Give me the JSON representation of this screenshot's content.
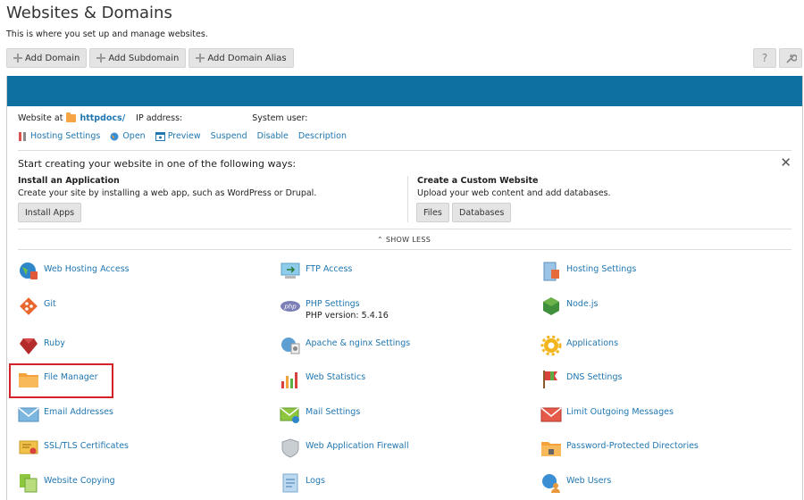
{
  "page": {
    "title": "Websites & Domains",
    "description": "This is where you set up and manage websites."
  },
  "toolbar": {
    "add_domain": "Add Domain",
    "add_subdomain": "Add Subdomain",
    "add_domain_alias": "Add Domain Alias",
    "help_glyph": "?",
    "tools_glyph": "🔧"
  },
  "site": {
    "website_at_label": "Website at",
    "docroot_link": "httpdocs/",
    "ip_label": "IP address:",
    "ip_value": "",
    "system_user_label": "System user:",
    "system_user_value": ""
  },
  "actions": {
    "hosting_settings": "Hosting Settings",
    "open": "Open",
    "preview": "Preview",
    "suspend": "Suspend",
    "disable": "Disable",
    "description": "Description"
  },
  "start": {
    "title": "Start creating your website in one of the following ways:",
    "close_glyph": "✕",
    "install_title": "Install an Application",
    "install_desc": "Create your site by installing a web app, such as WordPress or Drupal.",
    "install_button": "Install Apps",
    "custom_title": "Create a Custom Website",
    "custom_desc": "Upload your web content and add databases.",
    "files_button": "Files",
    "databases_button": "Databases",
    "show_less": "SHOW LESS",
    "chevron_glyph": "⌃"
  },
  "tools": [
    {
      "label": "Web Hosting Access",
      "icon": "web-hosting-access-icon"
    },
    {
      "label": "FTP Access",
      "icon": "ftp-access-icon"
    },
    {
      "label": "Hosting Settings",
      "icon": "hosting-settings-icon"
    },
    {
      "label": "Git",
      "icon": "git-icon"
    },
    {
      "label": "PHP Settings",
      "icon": "php-icon",
      "sub": "PHP version: 5.4.16"
    },
    {
      "label": "Node.js",
      "icon": "nodejs-icon"
    },
    {
      "label": "Ruby",
      "icon": "ruby-icon"
    },
    {
      "label": "Apache & nginx Settings",
      "icon": "apache-nginx-icon"
    },
    {
      "label": "Applications",
      "icon": "applications-gear-icon"
    },
    {
      "label": "File Manager",
      "icon": "folder-icon"
    },
    {
      "label": "Web Statistics",
      "icon": "bar-chart-icon"
    },
    {
      "label": "DNS Settings",
      "icon": "dns-flag-icon"
    },
    {
      "label": "Email Addresses",
      "icon": "envelope-icon"
    },
    {
      "label": "Mail Settings",
      "icon": "mail-settings-icon"
    },
    {
      "label": "Limit Outgoing Messages",
      "icon": "limit-mail-icon"
    },
    {
      "label": "SSL/TLS Certificates",
      "icon": "certificate-icon"
    },
    {
      "label": "Web Application Firewall",
      "icon": "shield-icon"
    },
    {
      "label": "Password-Protected Directories",
      "icon": "locked-folder-icon"
    },
    {
      "label": "Website Copying",
      "icon": "copy-pages-icon"
    },
    {
      "label": "Logs",
      "icon": "logs-icon"
    },
    {
      "label": "Web Users",
      "icon": "web-users-icon"
    }
  ],
  "colors": {
    "header_bar": "#0d70a0",
    "link": "#2177b0",
    "highlight": "#d42127"
  }
}
